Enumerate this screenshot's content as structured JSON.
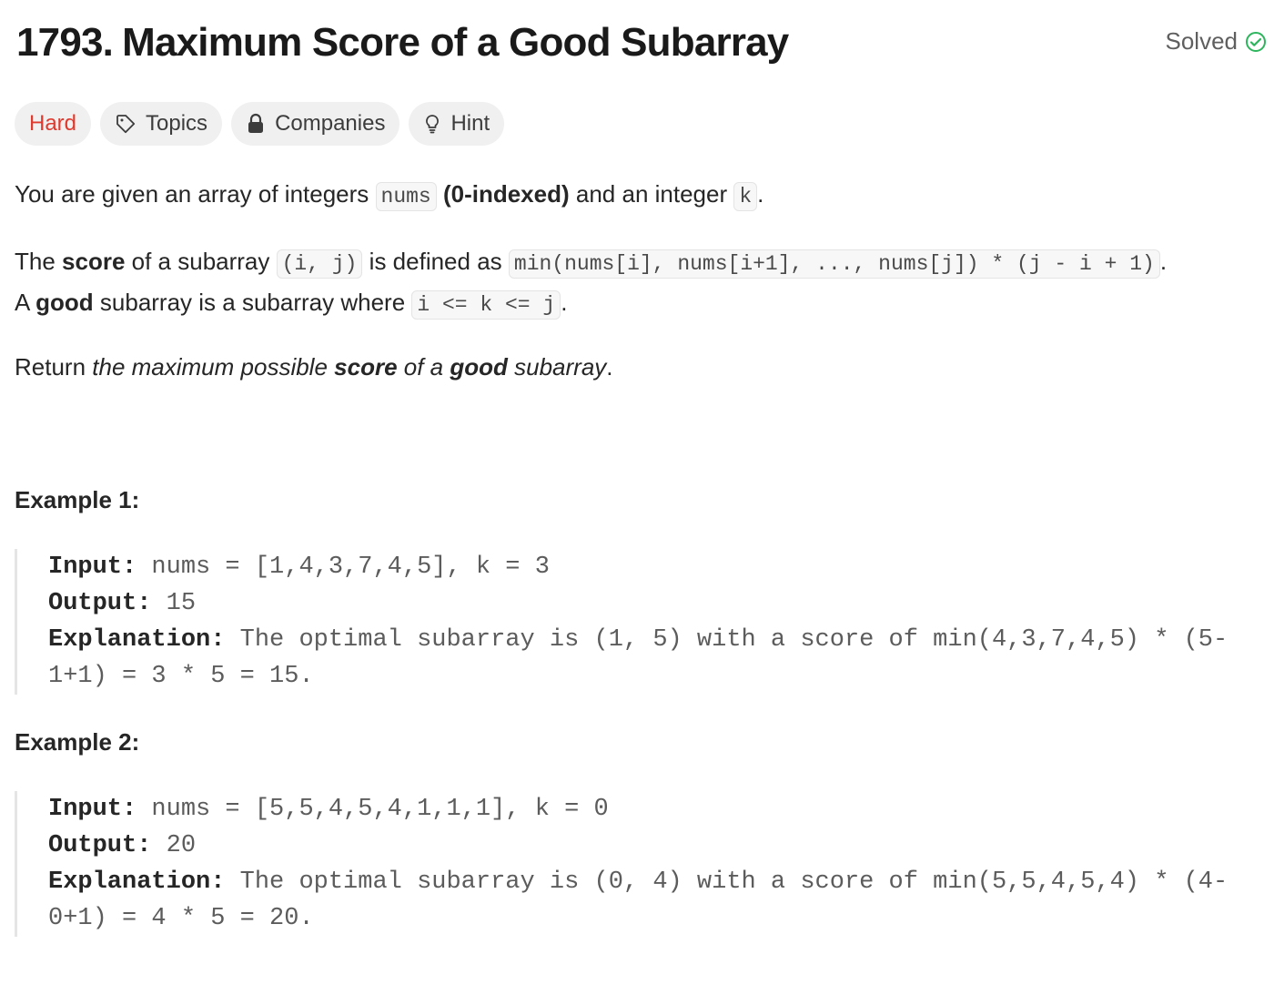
{
  "problem": {
    "number": "1793.",
    "title": "Maximum Score of a Good Subarray",
    "status": "Solved"
  },
  "tags": {
    "difficulty": "Hard",
    "topics": "Topics",
    "companies": "Companies",
    "hint": "Hint"
  },
  "description": {
    "p1": {
      "t1": "You are given an array of integers ",
      "c1": "nums",
      "b1": " (0-indexed)",
      "t2": " and an integer ",
      "c2": "k",
      "t3": "."
    },
    "p2": {
      "t1": "The ",
      "b1": "score",
      "t2": " of a subarray ",
      "c1": "(i, j)",
      "t3": " is defined as ",
      "c2": "min(nums[i], nums[i+1], ..., nums[j]) * (j - i + 1)",
      "t4": ".",
      "t5": "A ",
      "b2": "good",
      "t6": " subarray is a subarray where ",
      "c3": "i <= k <= j",
      "t7": "."
    },
    "p3": {
      "t1": "Return ",
      "i1": "the maximum possible ",
      "ib1": "score",
      "i2": " of a ",
      "ib2": "good",
      "i3": " subarray",
      "t2": "."
    }
  },
  "examples": [
    {
      "title": "Example 1:",
      "input_label": "Input:",
      "input": " nums = [1,4,3,7,4,5], k = 3",
      "output_label": "Output:",
      "output": " 15",
      "explanation_label": "Explanation:",
      "explanation": " The optimal subarray is (1, 5) with a score of min(4,3,7,4,5) * (5-1+1) = 3 * 5 = 15."
    },
    {
      "title": "Example 2:",
      "input_label": "Input:",
      "input": " nums = [5,5,4,5,4,1,1,1], k = 0",
      "output_label": "Output:",
      "output": " 20",
      "explanation_label": "Explanation:",
      "explanation": " The optimal subarray is (0, 4) with a score of min(5,5,4,5,4) * (4-0+1) = 4 * 5 = 20."
    }
  ],
  "colors": {
    "hard": "#e0392d",
    "solved_check": "#2db55d"
  },
  "icons": {
    "solved": "check-circle-icon",
    "topics": "tag-icon",
    "companies": "lock-icon",
    "hint": "lightbulb-icon"
  }
}
